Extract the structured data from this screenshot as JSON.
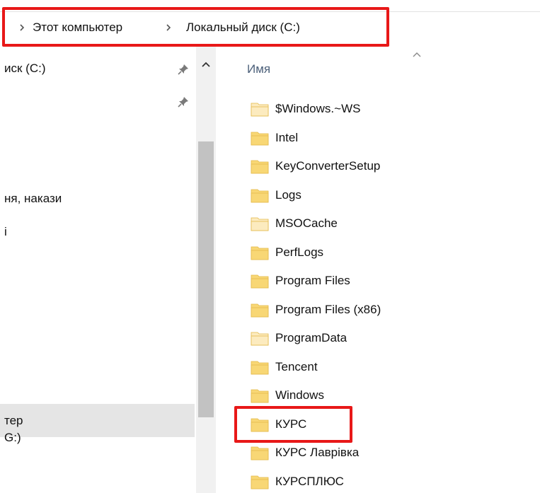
{
  "breadcrumb": {
    "items": [
      "Этот компьютер",
      "Локальный диск (C:)"
    ]
  },
  "nav": {
    "items": [
      {
        "label": "иск (C:)"
      },
      {
        "label": "ня, накази"
      },
      {
        "label": "і"
      },
      {
        "label": "тер"
      },
      {
        "label": "G:)"
      }
    ]
  },
  "content": {
    "column_name": "Имя",
    "files": [
      {
        "name": "$Windows.~WS",
        "faded": true
      },
      {
        "name": "Intel",
        "faded": false
      },
      {
        "name": "KeyConverterSetup",
        "faded": false
      },
      {
        "name": "Logs",
        "faded": false
      },
      {
        "name": "MSOCache",
        "faded": true
      },
      {
        "name": "PerfLogs",
        "faded": false
      },
      {
        "name": "Program Files",
        "faded": false
      },
      {
        "name": "Program Files (x86)",
        "faded": false
      },
      {
        "name": "ProgramData",
        "faded": true
      },
      {
        "name": "Tencent",
        "faded": false
      },
      {
        "name": "Windows",
        "faded": false
      },
      {
        "name": "КУРС",
        "faded": false
      },
      {
        "name": "КУРС Лаврівка",
        "faded": false
      },
      {
        "name": "КУРСПЛЮС",
        "faded": false
      }
    ]
  },
  "colors": {
    "highlight": "#e81818",
    "folder": "#f8d775",
    "folder_faded": "#fcebbf",
    "header_text": "#4c607a",
    "selection": "#e5e5e5"
  }
}
